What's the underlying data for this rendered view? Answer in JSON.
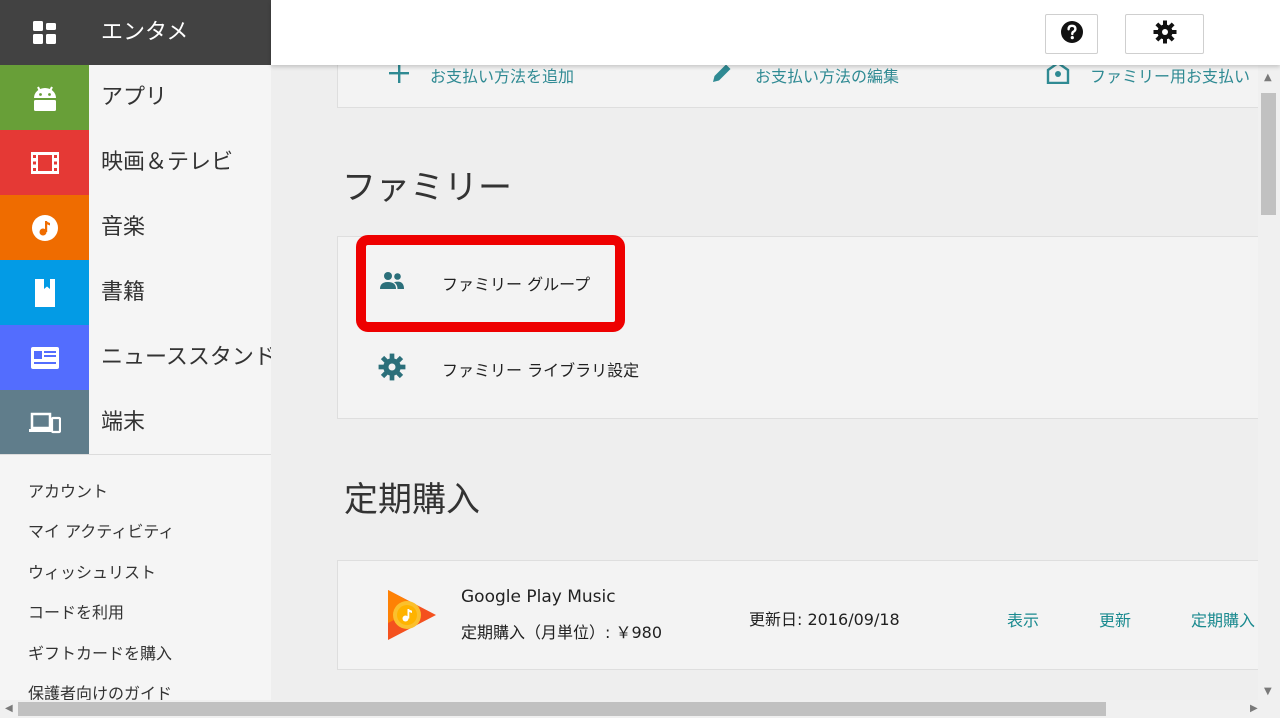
{
  "sidebar": {
    "categories": [
      {
        "label": "エンタメ",
        "icon": "apps-grid-icon",
        "color": "#424242"
      },
      {
        "label": "アプリ",
        "icon": "android-icon",
        "color": "#689f38"
      },
      {
        "label": "映画＆テレビ",
        "icon": "film-icon",
        "color": "#e53935"
      },
      {
        "label": "音楽",
        "icon": "music-note-icon",
        "color": "#ef6c00"
      },
      {
        "label": "書籍",
        "icon": "book-icon",
        "color": "#039be5"
      },
      {
        "label": "ニューススタンド",
        "icon": "newsstand-icon",
        "color": "#536dfe"
      },
      {
        "label": "端末",
        "icon": "devices-icon",
        "color": "#607d8b"
      }
    ],
    "account_links": [
      "アカウント",
      "マイ アクティビティ",
      "ウィッシュリスト",
      "コードを利用",
      "ギフトカードを購入",
      "保護者向けのガイド"
    ]
  },
  "topbar": {
    "help_icon": "help-icon",
    "settings_icon": "gear-icon"
  },
  "payment": {
    "items": [
      {
        "label": "お支払い方法を追加",
        "icon": "plus-icon"
      },
      {
        "label": "お支払い方法の編集",
        "icon": "pencil-icon"
      },
      {
        "label": "ファミリー用お支払い",
        "icon": "family-payment-icon"
      }
    ]
  },
  "family": {
    "title": "ファミリー",
    "items": [
      {
        "label": "ファミリー グループ",
        "icon": "family-group-icon"
      },
      {
        "label": "ファミリー ライブラリ設定",
        "icon": "gear-icon"
      }
    ],
    "highlight_color": "#ee0000"
  },
  "subscriptions": {
    "title": "定期購入",
    "items": [
      {
        "name": "Google Play Music",
        "detail": "定期購入（月単位）: ￥980",
        "renewal": "更新日: 2016/09/18",
        "actions": [
          "表示",
          "更新",
          "定期購入"
        ],
        "icon": "play-music-icon"
      }
    ]
  },
  "colors": {
    "accent": "#2f8a93",
    "link": "#1a8a8f"
  }
}
